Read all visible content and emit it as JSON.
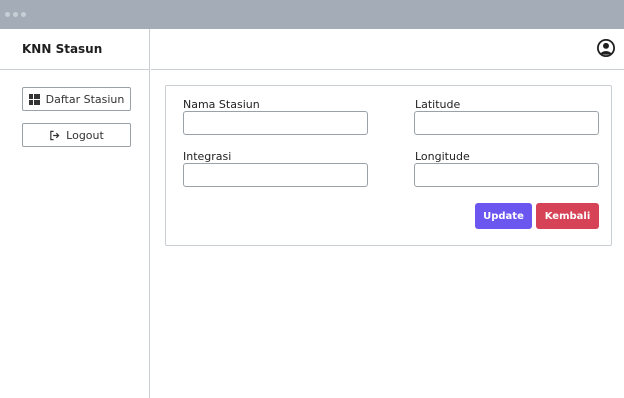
{
  "app": {
    "brand": "KNN Stasun"
  },
  "sidebar": {
    "items": [
      {
        "label": "Daftar Stasiun",
        "icon": "dashboard-icon"
      },
      {
        "label": "Logout",
        "icon": "logout-icon"
      }
    ]
  },
  "topbar": {
    "avatar_icon": "user-circle-icon"
  },
  "form": {
    "nama_stasiun": {
      "label": "Nama Stasiun",
      "value": ""
    },
    "latitude": {
      "label": "Latitude",
      "value": ""
    },
    "integrasi": {
      "label": "Integrasi",
      "value": ""
    },
    "longitude": {
      "label": "Longitude",
      "value": ""
    },
    "update_label": "Update",
    "kembali_label": "Kembali"
  },
  "colors": {
    "update": "#6b57f0",
    "kembali": "#d64356",
    "titlebar": "#a3acb7"
  }
}
